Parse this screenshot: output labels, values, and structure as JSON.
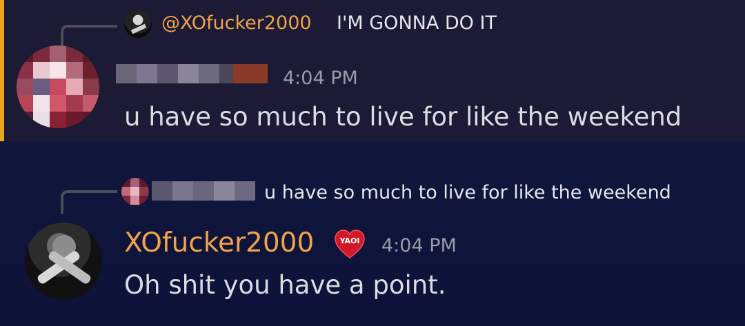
{
  "highlighted_message": {
    "reply": {
      "author": "@XOfucker2000",
      "text": "I'M GONNA DO IT"
    },
    "timestamp": "4:04 PM",
    "text": "u have so much to live for like the weekend"
  },
  "second_message": {
    "reply": {
      "text": "u have so much to live for like the weekend"
    },
    "author": "XOfucker2000",
    "badge": "YAOI",
    "timestamp": "4:04 PM",
    "text": "Oh shit you have a point."
  },
  "colors": {
    "accent_bar": "#e9a621",
    "username": "#f0a34a",
    "badge_heart": "#d0192b"
  }
}
